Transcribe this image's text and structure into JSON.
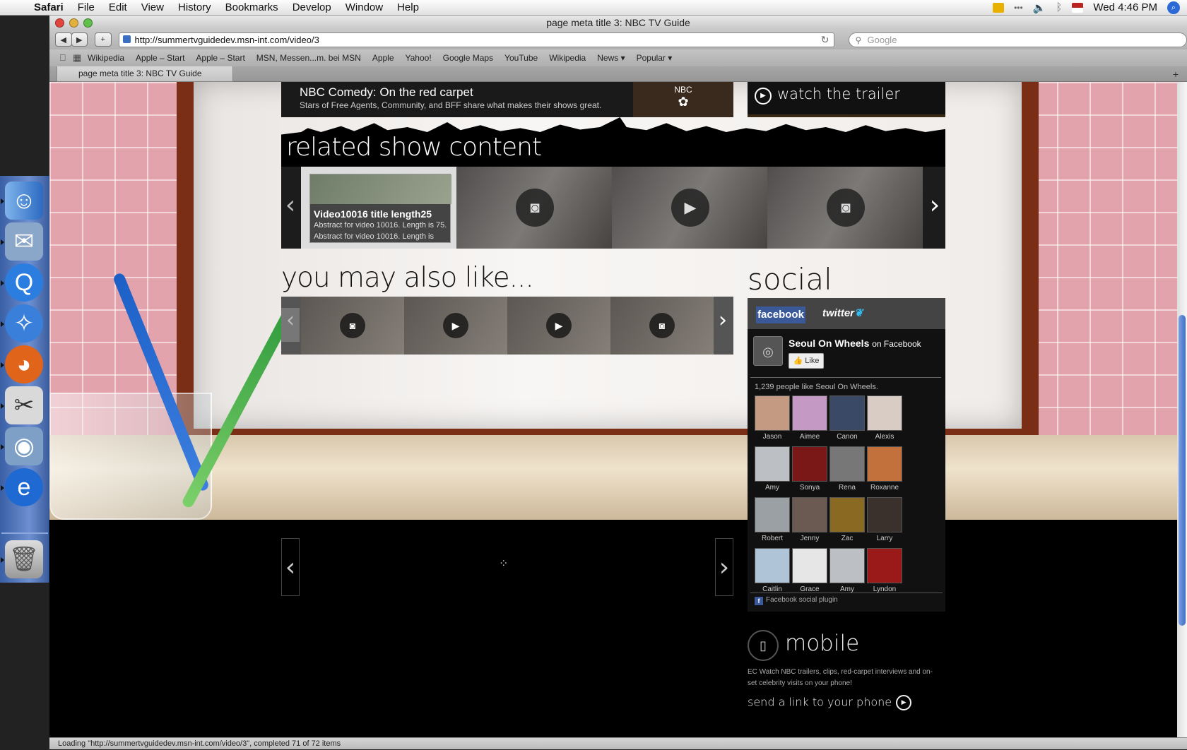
{
  "menubar": {
    "items": [
      "Safari",
      "File",
      "Edit",
      "View",
      "History",
      "Bookmarks",
      "Develop",
      "Window",
      "Help"
    ],
    "clock": "Wed 4:46 PM"
  },
  "window": {
    "title": "page meta title 3: NBC TV Guide",
    "url": "http://summertvguidedev.msn-int.com/video/3",
    "search_placeholder": "Google",
    "bookmarks": [
      "Wikipedia",
      "Apple – Start",
      "Apple – Start",
      "MSN, Messen...m. bei MSN",
      "Apple",
      "Yahoo!",
      "Google Maps",
      "YouTube",
      "Wikipedia",
      "News ▾",
      "Popular ▾"
    ],
    "tab_title": "page meta title 3: NBC TV Guide",
    "status": "Loading \"http://summertvguidedev.msn-int.com/video/3\", completed 71 of 72 items"
  },
  "page": {
    "promo_title": "NBC Comedy: On the red carpet",
    "promo_sub": "Stars of Free Agents, Community, and BFF share what makes their shows great.",
    "nbc_label": "NBC",
    "trailer_label": "watch the trailer",
    "related_title": "related show content",
    "hover": {
      "title": "Video10016 title length25",
      "line1": "Abstract for video 10016. Length is 75.",
      "line2": "Abstract for video 10016. Length is"
    },
    "ymal_title": "you may also like...",
    "social_title": "social",
    "facebook_tab": "facebook",
    "twitter_tab": "twitter",
    "fb_page": "Seoul On Wheels",
    "fb_on": "on Facebook",
    "fb_like": "Like",
    "fb_count": "1,239 people like Seoul On Wheels.",
    "fans": [
      [
        "Jason",
        "Aimee",
        "Canon",
        "Alexis"
      ],
      [
        "Amy",
        "Sonya",
        "Rena",
        "Roxanne"
      ],
      [
        "Robert",
        "Jenny",
        "Zac",
        "Larry"
      ],
      [
        "Caitlin",
        "Grace",
        "Amy",
        "Lyndon"
      ]
    ],
    "fb_plugin": "Facebook social plugin",
    "mobile_title": "mobile",
    "mobile_desc": "EC Watch NBC trailers, clips, red-carpet interviews and on-set celebrity visits on your phone!",
    "mobile_send": "send a link to your phone"
  }
}
